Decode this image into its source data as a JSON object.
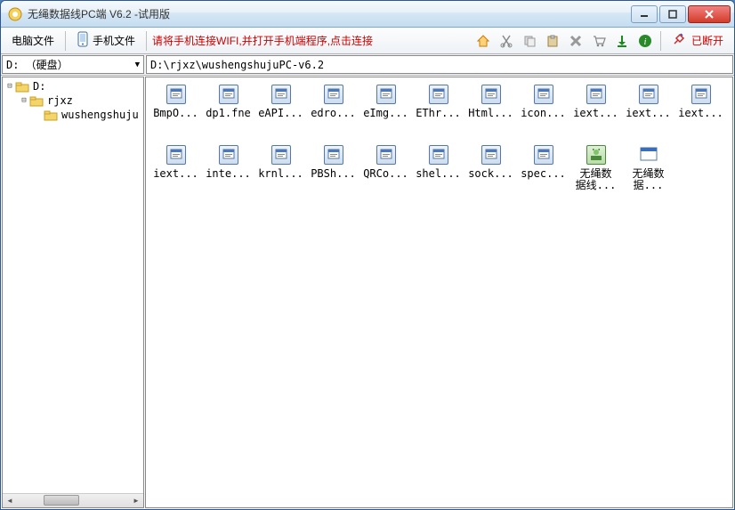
{
  "title": "无绳数据线PC端 V6.2 -试用版",
  "toolbar": {
    "pcFiles": "电脑文件",
    "phoneFiles": "手机文件",
    "hint": "请将手机连接WIFI,并打开手机端程序,点击连接",
    "status": "已断开"
  },
  "drive": {
    "selected": "D: （硬盘）"
  },
  "path": "D:\\rjxz\\wushengshujuPC-v6.2",
  "tree": {
    "root": "D:",
    "child1": "rjxz",
    "child2": "wushengshuju"
  },
  "files": [
    {
      "label": "BmpO...",
      "kind": "fne"
    },
    {
      "label": "dp1.fne",
      "kind": "fne"
    },
    {
      "label": "eAPI...",
      "kind": "fne"
    },
    {
      "label": "edro...",
      "kind": "fne"
    },
    {
      "label": "eImg...",
      "kind": "fne"
    },
    {
      "label": "EThr...",
      "kind": "fne"
    },
    {
      "label": "Html...",
      "kind": "fne"
    },
    {
      "label": "icon...",
      "kind": "fne"
    },
    {
      "label": "iext...",
      "kind": "fne"
    },
    {
      "label": "iext...",
      "kind": "fne"
    },
    {
      "label": "iext...",
      "kind": "fne"
    },
    {
      "label": "iext...",
      "kind": "fne"
    },
    {
      "label": "inte...",
      "kind": "fne"
    },
    {
      "label": "krnl...",
      "kind": "fne"
    },
    {
      "label": "PBSh...",
      "kind": "fne"
    },
    {
      "label": "QRCo...",
      "kind": "fne-light"
    },
    {
      "label": "shel...",
      "kind": "fne"
    },
    {
      "label": "sock...",
      "kind": "fne"
    },
    {
      "label": "spec...",
      "kind": "fne"
    },
    {
      "label": "无绳数\n据线...",
      "kind": "exe"
    },
    {
      "label": "无绳数\n据...",
      "kind": "app"
    }
  ]
}
